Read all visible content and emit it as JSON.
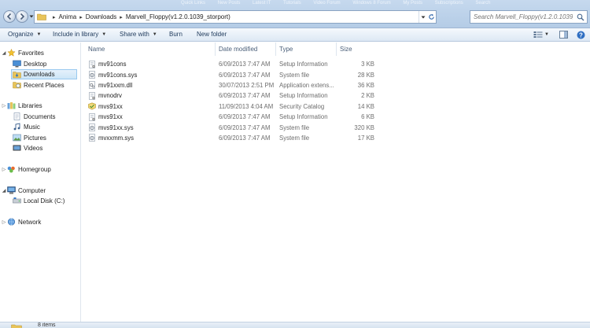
{
  "titlebar": {
    "background_links": [
      "Quick Links",
      "New Posts",
      "Latest IT",
      "Tutorials",
      "Video Forum",
      "Windows 8 Forum",
      "My Posts",
      "Subscriptions",
      "Search"
    ]
  },
  "address": {
    "crumbs": [
      "Anima",
      "Downloads",
      "Marvell_Floppy(v1.2.0.1039_storport)"
    ]
  },
  "search": {
    "placeholder": "Search Marvell_Floppy(v1.2.0.1039_sto..."
  },
  "toolbar": {
    "organize": "Organize",
    "include_in_library": "Include in library",
    "share_with": "Share with",
    "burn": "Burn",
    "new_folder": "New folder"
  },
  "navpane": {
    "favorites": "Favorites",
    "desktop": "Desktop",
    "downloads": "Downloads",
    "recent_places": "Recent Places",
    "libraries": "Libraries",
    "documents": "Documents",
    "music": "Music",
    "pictures": "Pictures",
    "videos": "Videos",
    "homegroup": "Homegroup",
    "computer": "Computer",
    "local_disk": "Local Disk (C:)",
    "network": "Network"
  },
  "columns": {
    "name": "Name",
    "date_modified": "Date modified",
    "type": "Type",
    "size": "Size"
  },
  "files": [
    {
      "name": "mv91cons",
      "date": "6/09/2013 7:47 AM",
      "type": "Setup Information",
      "size": "3 KB",
      "icon": "setup-info-icon"
    },
    {
      "name": "mv91cons.sys",
      "date": "6/09/2013 7:47 AM",
      "type": "System file",
      "size": "28 KB",
      "icon": "system-file-icon"
    },
    {
      "name": "mv91xxm.dll",
      "date": "30/07/2013 2:51 PM",
      "type": "Application extens...",
      "size": "36 KB",
      "icon": "dll-file-icon"
    },
    {
      "name": "mvnodrv",
      "date": "6/09/2013 7:47 AM",
      "type": "Setup Information",
      "size": "2 KB",
      "icon": "setup-info-icon"
    },
    {
      "name": "mvs91xx",
      "date": "11/09/2013 4:04 AM",
      "type": "Security Catalog",
      "size": "14 KB",
      "icon": "security-catalog-icon"
    },
    {
      "name": "mvs91xx",
      "date": "6/09/2013 7:47 AM",
      "type": "Setup Information",
      "size": "6 KB",
      "icon": "setup-info-icon"
    },
    {
      "name": "mvs91xx.sys",
      "date": "6/09/2013 7:47 AM",
      "type": "System file",
      "size": "320 KB",
      "icon": "system-file-icon"
    },
    {
      "name": "mvxxmm.sys",
      "date": "6/09/2013 7:47 AM",
      "type": "System file",
      "size": "17 KB",
      "icon": "system-file-icon"
    }
  ],
  "status": {
    "item_count": "8 items"
  },
  "colors": {
    "accent": "#1e395b",
    "selection": "#cde6f7",
    "toolbar_bg": "#dde8f4"
  }
}
